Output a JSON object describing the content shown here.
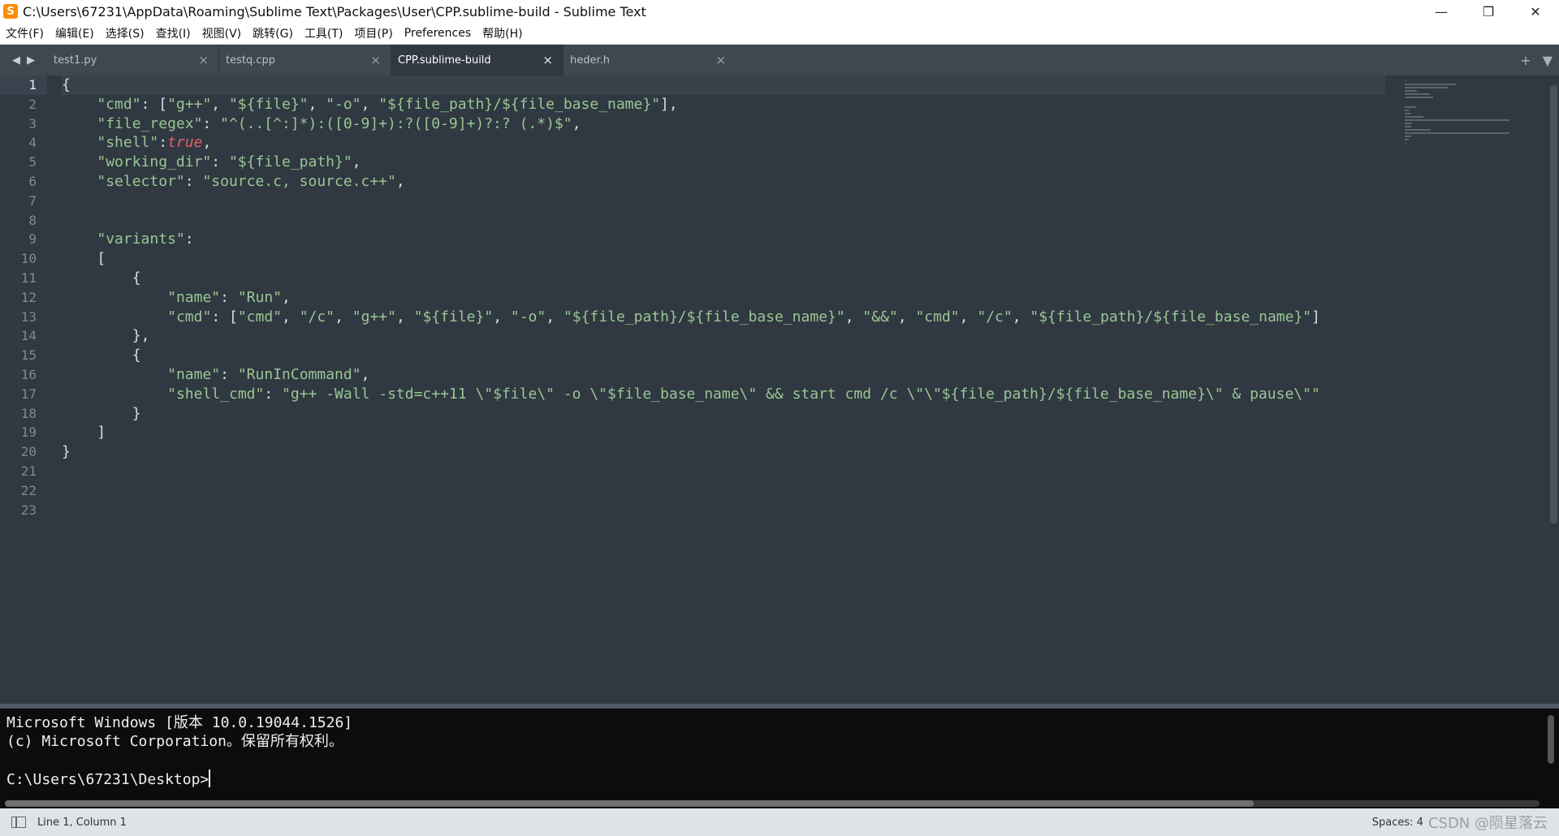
{
  "window": {
    "title": "C:\\Users\\67231\\AppData\\Roaming\\Sublime Text\\Packages\\User\\CPP.sublime-build - Sublime Text",
    "app_icon": "S",
    "controls": [
      "—",
      "❐",
      "✕"
    ]
  },
  "menu": [
    "文件(F)",
    "编辑(E)",
    "选择(S)",
    "查找(I)",
    "视图(V)",
    "跳转(G)",
    "工具(T)",
    "项目(P)",
    "Preferences",
    "帮助(H)"
  ],
  "tabs": [
    {
      "label": "test1.py"
    },
    {
      "label": "testq.cpp"
    },
    {
      "label": "CPP.sublime-build",
      "active": true
    },
    {
      "label": "heder.h"
    }
  ],
  "tab_nav": {
    "left": "◀",
    "right": "▶",
    "add": "+",
    "menu": "▼"
  },
  "editor": {
    "line_numbers": [
      "1",
      "2",
      "3",
      "4",
      "5",
      "6",
      "7",
      "8",
      "9",
      "10",
      "11",
      "12",
      "13",
      "14",
      "15",
      "16",
      "17",
      "18",
      "19",
      "20",
      "21",
      "22",
      "23"
    ],
    "current_line": 1,
    "lines": [
      "{",
      "    \"cmd\": [\"g++\", \"${file}\", \"-o\", \"${file_path}/${file_base_name}\"],",
      "    \"file_regex\": \"^(..[^:]*):([0-9]+):?([0-9]+)?:? (.*)$\",",
      "    \"shell\":true,",
      "    \"working_dir\": \"${file_path}\",",
      "    \"selector\": \"source.c, source.c++\",",
      "",
      "",
      "    \"variants\":",
      "    [",
      "        {",
      "            \"name\": \"Run\",",
      "            \"cmd\": [\"cmd\", \"/c\", \"g++\", \"${file}\", \"-o\", \"${file_path}/${file_base_name}\", \"&&\", \"cmd\", \"/c\", \"${file_path}/${file_base_name}\"]",
      "        },",
      "        {",
      "            \"name\": \"RunInCommand\",",
      "            \"shell_cmd\": \"g++ -Wall -std=c++11 \\\"$file\\\" -o \\\"$file_base_name\\\" && start cmd /c \\\"\\\"${file_path}/${file_base_name}\\\" & pause\\\"\"",
      "        }",
      "    ]",
      "}",
      "",
      "",
      ""
    ]
  },
  "terminal": {
    "lines": [
      "Microsoft Windows [版本 10.0.19044.1526]",
      "(c) Microsoft Corporation。保留所有权利。",
      "",
      "C:\\Users\\67231\\Desktop>"
    ]
  },
  "status": {
    "position": "Line 1, Column 1",
    "spaces": "Spaces: 4",
    "watermark": "CSDN @陨星落云"
  }
}
